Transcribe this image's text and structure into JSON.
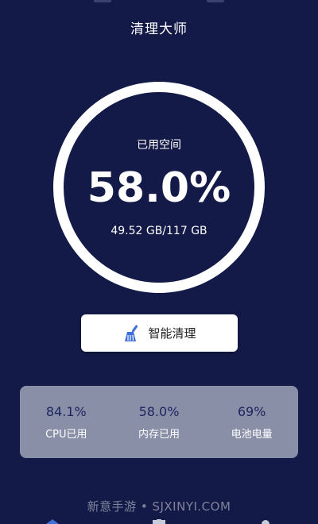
{
  "header": {
    "title": "清理大师"
  },
  "storage": {
    "label": "已用空间",
    "percent": "58.0%",
    "detail": "49.52 GB/117 GB"
  },
  "action": {
    "clean_label": "智能清理",
    "icon": "broom-icon"
  },
  "stats": [
    {
      "value": "84.1%",
      "label": "CPU已用"
    },
    {
      "value": "58.0%",
      "label": "内存已用"
    },
    {
      "value": "69%",
      "label": "电池电量"
    }
  ],
  "watermark": "新意手游 • SJXINYI.COM",
  "colors": {
    "background": "#131a47",
    "ring": "#ffffff",
    "card": "#8a8fa8",
    "stat_value": "#1c2560",
    "icon_blue": "#3f6fd8"
  }
}
